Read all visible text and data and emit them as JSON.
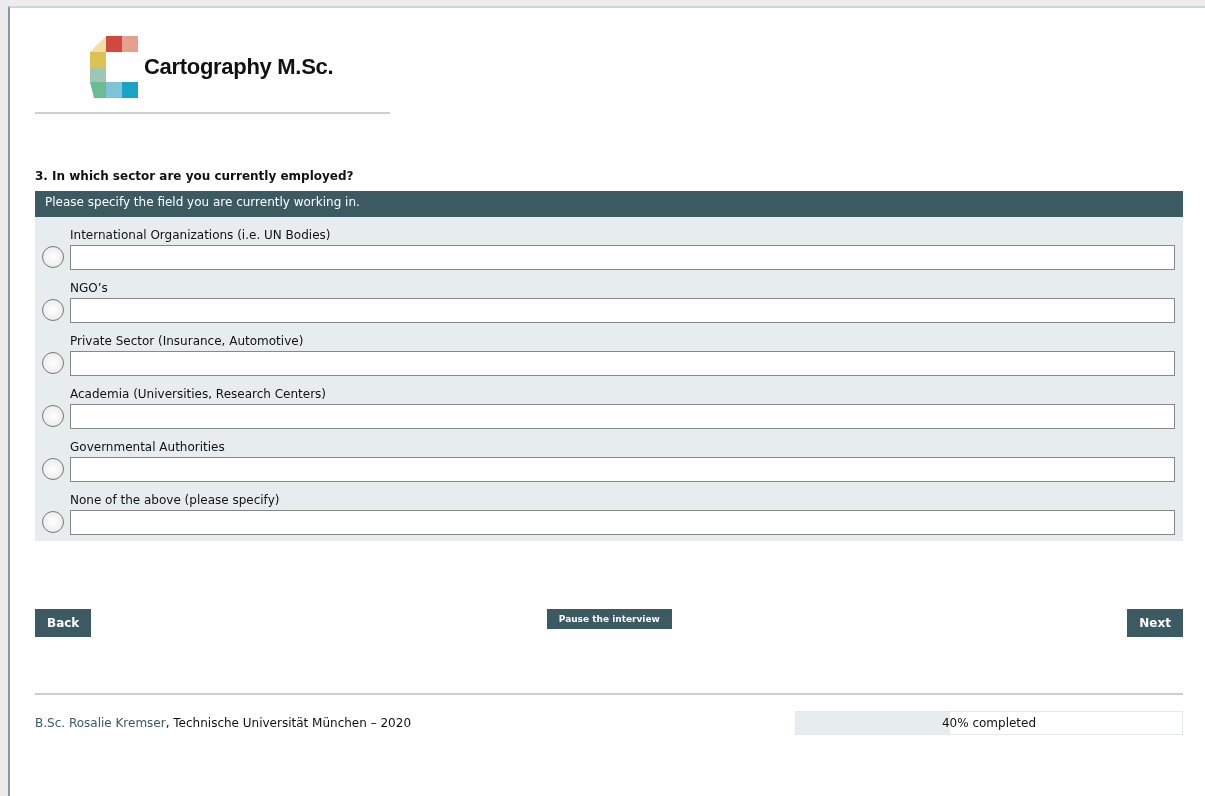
{
  "logo": {
    "text": "Cartography M.Sc."
  },
  "question": {
    "title": "3. In which sector are you currently employed?",
    "instruction": "Please specify the field you are currently working in.",
    "options": [
      {
        "label": "International Organizations (i.e. UN Bodies)",
        "selected": false
      },
      {
        "label": "NGO’s",
        "selected": false
      },
      {
        "label": "Private Sector (Insurance, Automotive)",
        "selected": false
      },
      {
        "label": "Academia (Universities, Research Centers)",
        "selected": false
      },
      {
        "label": "Governmental Authorities",
        "selected": false
      },
      {
        "label": "None of the above (please specify)",
        "selected": false
      }
    ]
  },
  "buttons": {
    "back": "Back",
    "pause": "Pause the interview",
    "next": "Next"
  },
  "footer": {
    "author": "B.Sc. Rosalie Kremser",
    "text": ", Technische Universität München – 2020"
  },
  "progress": {
    "level": 0.4,
    "label": "40% completed"
  }
}
